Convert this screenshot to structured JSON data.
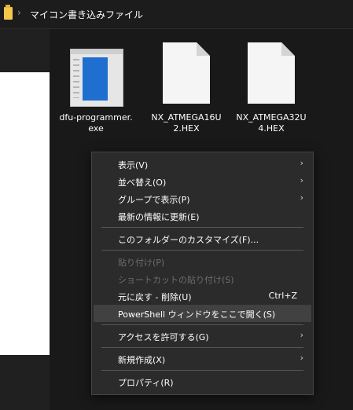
{
  "address_bar": {
    "separator": "›",
    "path": "マイコン書き込みファイル"
  },
  "files": [
    {
      "name_line1": "dfu-programmer.",
      "name_line2": "exe",
      "icon": "exe-app-icon"
    },
    {
      "name_line1": "NX_ATMEGA16U",
      "name_line2": "2.HEX",
      "icon": "hex-file-icon"
    },
    {
      "name_line1": "NX_ATMEGA32U",
      "name_line2": "4.HEX",
      "icon": "hex-file-icon"
    }
  ],
  "context_menu": {
    "items": [
      {
        "label": "表示(V)",
        "submenu": true
      },
      {
        "label": "並べ替え(O)",
        "submenu": true
      },
      {
        "label": "グループで表示(P)",
        "submenu": true
      },
      {
        "label": "最新の情報に更新(E)"
      },
      {
        "label": "このフォルダーのカスタマイズ(F)..."
      },
      {
        "label": "貼り付け(P)",
        "disabled": true
      },
      {
        "label": "ショートカットの貼り付け(S)",
        "disabled": true
      },
      {
        "label": "元に戻す - 削除(U)",
        "shortcut": "Ctrl+Z"
      },
      {
        "label": "PowerShell ウィンドウをここで開く(S)",
        "highlighted": true
      },
      {
        "label": "アクセスを許可する(G)",
        "submenu": true
      },
      {
        "label": "新規作成(X)",
        "submenu": true
      },
      {
        "label": "プロパティ(R)"
      }
    ],
    "submenu_arrow": "›"
  },
  "colors": {
    "background": "#191919",
    "menu_background": "#2b2b2b",
    "menu_highlight": "#414141",
    "folder": "#f5c84c",
    "exe_accent": "#1e6fd0"
  }
}
